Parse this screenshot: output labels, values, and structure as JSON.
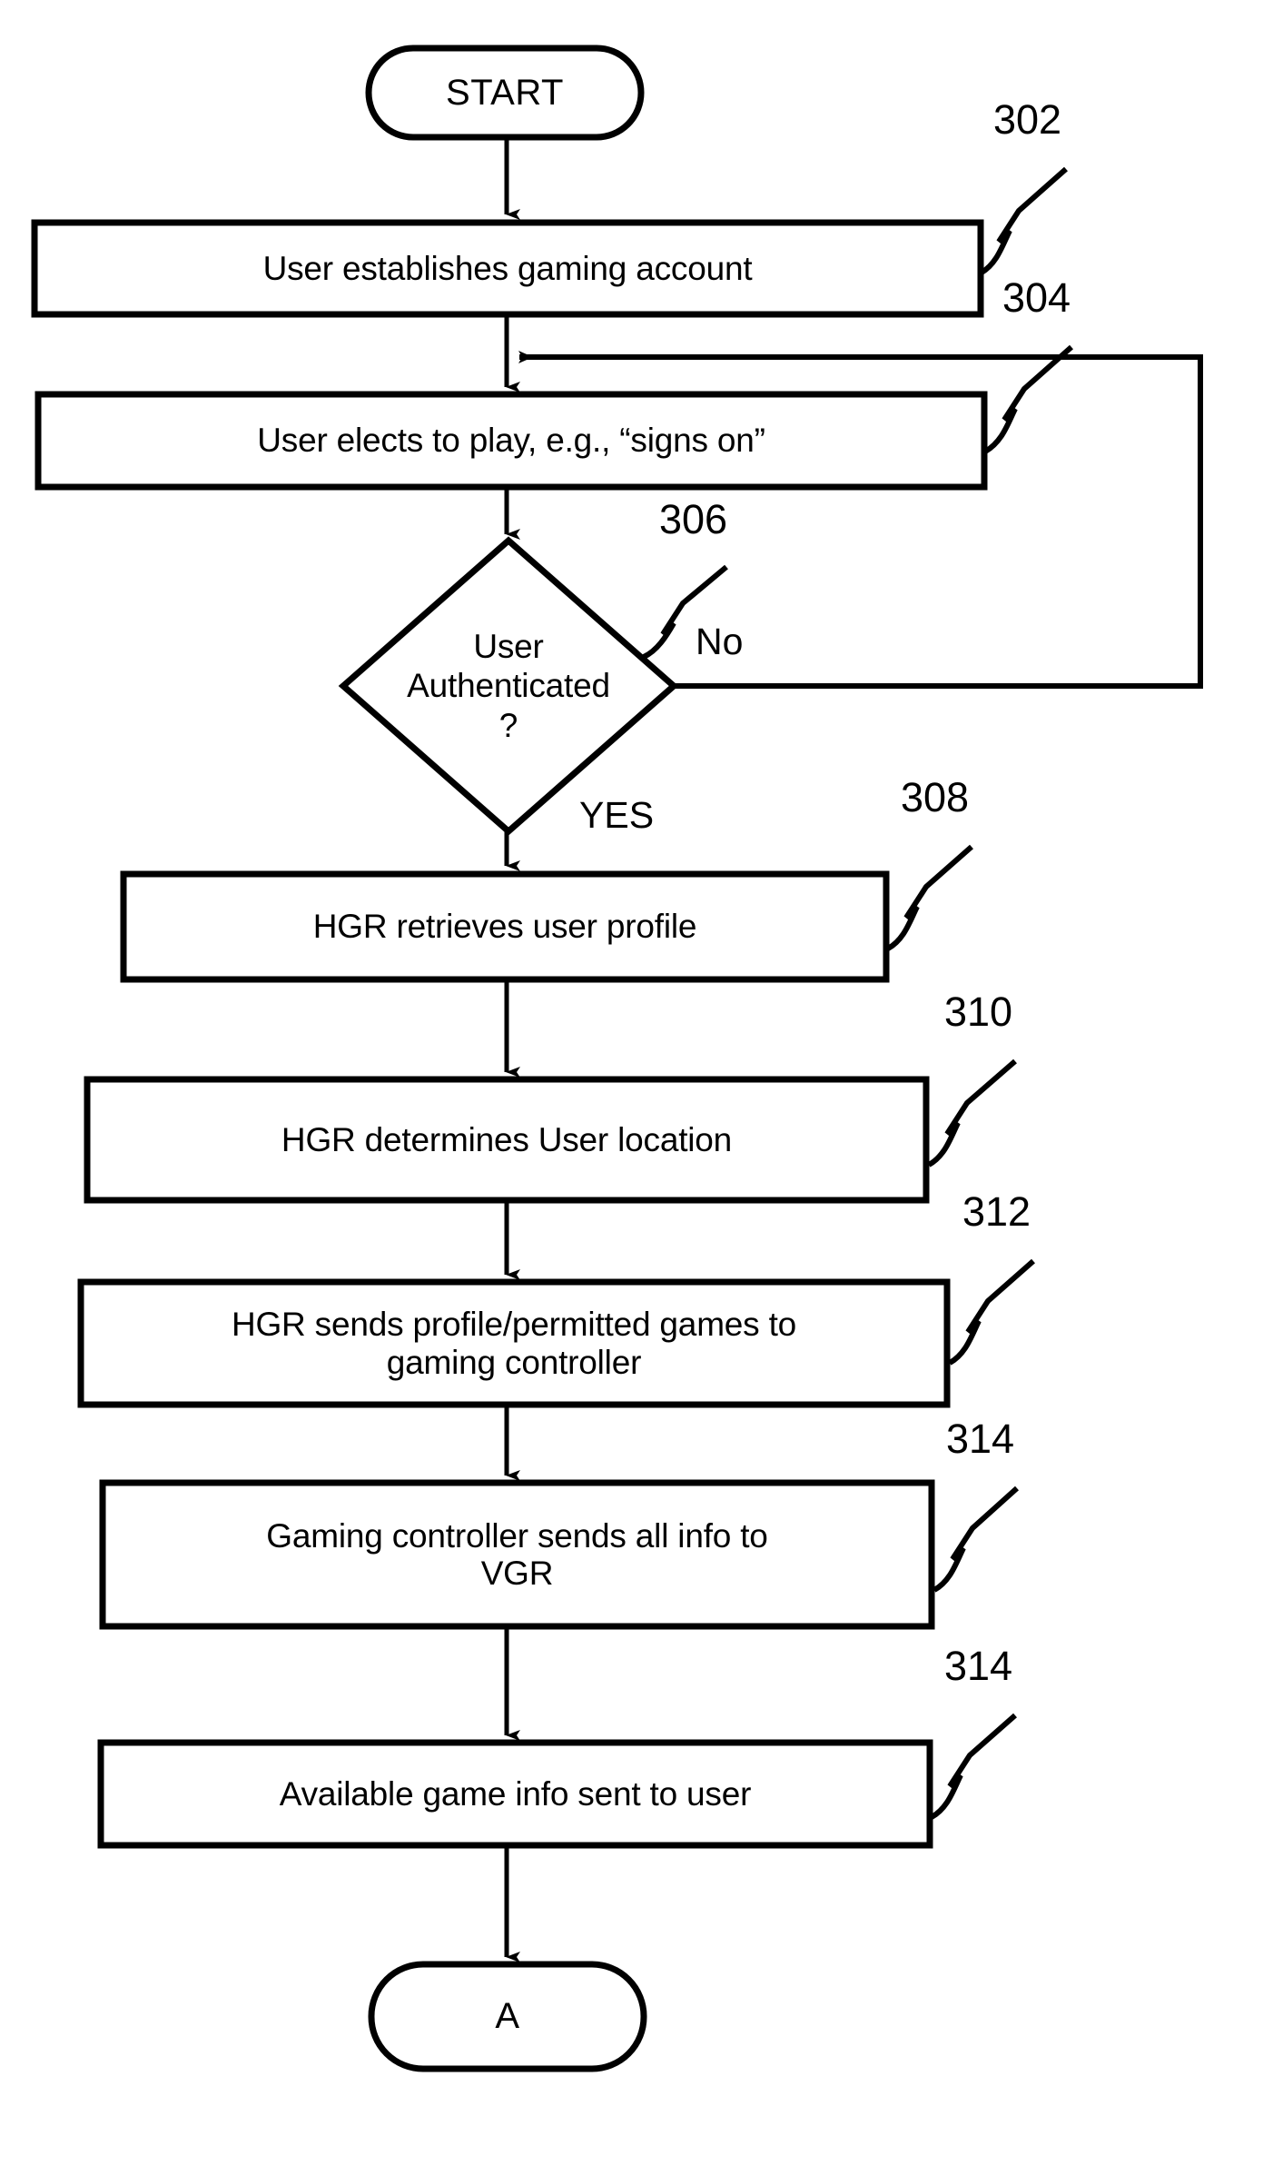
{
  "figure": {
    "type": "flowchart",
    "orientation": "vertical",
    "background_color": "#ffffff",
    "stroke_color": "#000000"
  },
  "nodes": {
    "start": {
      "id": "start",
      "shape": "terminator",
      "label": "START"
    },
    "step302": {
      "id": "302",
      "shape": "process",
      "label": "User establishes gaming  account"
    },
    "step304": {
      "id": "304",
      "shape": "process",
      "label": "User elects to play, e.g., “signs on”"
    },
    "decision306": {
      "id": "306",
      "shape": "decision",
      "label": "User\nAuthenticated\n?"
    },
    "step308": {
      "id": "308",
      "shape": "process",
      "label": "HGR retrieves user profile"
    },
    "step310": {
      "id": "310",
      "shape": "process",
      "label": "HGR determines User location"
    },
    "step312": {
      "id": "312",
      "shape": "process",
      "label": "HGR sends profile/permitted games to\ngaming controller"
    },
    "step314a": {
      "id": "314",
      "shape": "process",
      "label": "Gaming controller sends all info to\nVGR"
    },
    "step314b": {
      "id": "314",
      "shape": "process",
      "label": "Available game info sent to user"
    },
    "connectorA": {
      "id": "A",
      "shape": "terminator",
      "label": "A"
    }
  },
  "reference_numerals": {
    "ref302": "302",
    "ref304": "304",
    "ref306": "306",
    "ref308": "308",
    "ref310": "310",
    "ref312": "312",
    "ref314a": "314",
    "ref314b": "314"
  },
  "edge_labels": {
    "no_branch": "No",
    "yes_branch": "YES"
  },
  "edges": [
    {
      "from": "start",
      "to": "step302",
      "label": ""
    },
    {
      "from": "step302",
      "to": "step304",
      "label": ""
    },
    {
      "from": "step304",
      "to": "decision306",
      "label": ""
    },
    {
      "from": "decision306",
      "to": "step304",
      "label": "No"
    },
    {
      "from": "decision306",
      "to": "step308",
      "label": "YES"
    },
    {
      "from": "step308",
      "to": "step310",
      "label": ""
    },
    {
      "from": "step310",
      "to": "step312",
      "label": ""
    },
    {
      "from": "step312",
      "to": "step314a",
      "label": ""
    },
    {
      "from": "step314a",
      "to": "step314b",
      "label": ""
    },
    {
      "from": "step314b",
      "to": "connectorA",
      "label": ""
    }
  ]
}
